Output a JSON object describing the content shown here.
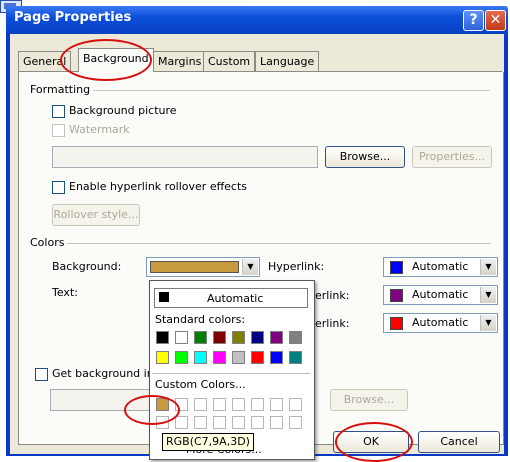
{
  "dialog": {
    "title": "Page Properties",
    "help_glyph": "?",
    "close_glyph": "✕"
  },
  "tabs": [
    {
      "label": "General"
    },
    {
      "label": "Background"
    },
    {
      "label": "Margins"
    },
    {
      "label": "Custom"
    },
    {
      "label": "Language"
    }
  ],
  "formatting": {
    "group_label": "Formatting",
    "background_picture": "Background picture",
    "watermark": "Watermark",
    "browse": "Browse...",
    "properties": "Properties...",
    "hyperlink_rollover": "Enable hyperlink rollover effects",
    "rollover_style": "Rollover style..."
  },
  "colors": {
    "group_label": "Colors",
    "background_label": "Background:",
    "text_label": "Text:",
    "hyperlink_label": "Hyperlink:",
    "visited_label": "erlink:",
    "active_label": "erlink:",
    "hyperlink_value": "Automatic",
    "visited_value": "Automatic",
    "active_value": "Automatic",
    "background_color": "#C79A3D",
    "hyperlink_color": "#0000FF",
    "visited_color": "#800080",
    "active_color": "#FF0000",
    "get_background": "Get background in",
    "browse2": "Browse..."
  },
  "dropdown": {
    "automatic": "Automatic",
    "standard_colors": "Standard colors:",
    "custom_colors": "Custom Colors...",
    "more_colors": "More Colors...",
    "standard_row1": [
      "#000000",
      "#FFFFFF",
      "#008000",
      "#800000",
      "#808000",
      "#000080",
      "#800080",
      "#808080"
    ],
    "standard_row2": [
      "#FFFF00",
      "#00FF00",
      "#00FFFF",
      "#FF00FF",
      "#C0C0C0",
      "#FF0000",
      "#0000FF",
      "#008080"
    ],
    "custom_row1": [
      "#C79A3D"
    ]
  },
  "tooltip": "RGB(C7,9A,3D)",
  "buttons": {
    "ok": "OK",
    "cancel": "Cancel"
  }
}
